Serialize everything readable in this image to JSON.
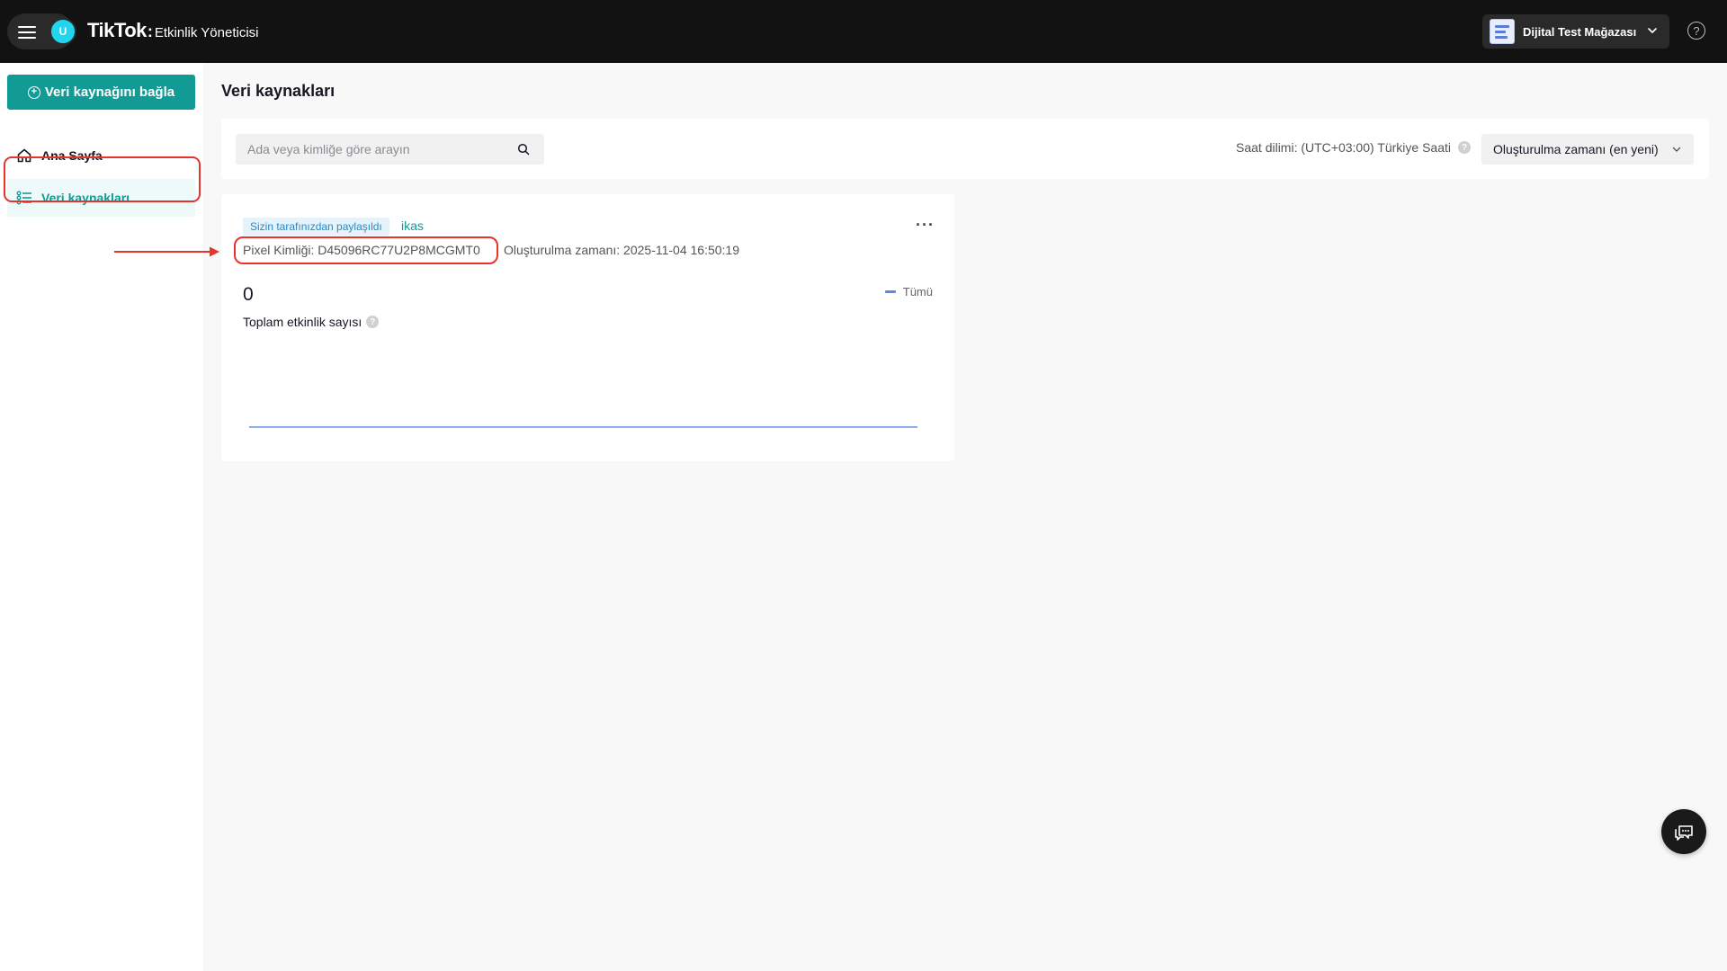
{
  "header": {
    "avatar_initial": "U",
    "brand_logo": "TikTok",
    "brand_colon": ":",
    "brand_subtitle": "Etkinlik Yöneticisi",
    "store_name": "Dijital Test Mağazası",
    "help_glyph": "?"
  },
  "sidebar": {
    "connect_button": "Veri kaynağını bağla",
    "items": [
      {
        "label": "Ana Sayfa",
        "icon": "home-icon",
        "active": false
      },
      {
        "label": "Veri kaynakları",
        "icon": "list-icon",
        "active": true
      }
    ]
  },
  "main": {
    "title": "Veri kaynakları",
    "search": {
      "placeholder": "Ada veya kimliğe göre arayın",
      "value": ""
    },
    "timezone": "Saat dilimi: (UTC+03:00) Türkiye Saati",
    "sort_selected": "Oluşturulma zamanı (en yeni)"
  },
  "card": {
    "shared_tag": "Sizin tarafınızdan paylaşıldı",
    "source_name": "ikas",
    "more": "···",
    "pixel_id": "Pixel Kimliği: D45096RC77U2P8MCGMT0",
    "created_at": "Oluşturulma zamanı: 2025-11-04 16:50:19",
    "total_value": "0",
    "total_label": "Toplam etkinlik sayısı",
    "legend_label": "Tümü",
    "series_value": 0
  },
  "colors": {
    "accent": "#129b95",
    "topbar": "#121212",
    "annotation_red": "#e8332c",
    "chart_line": "#8fb0ee"
  }
}
